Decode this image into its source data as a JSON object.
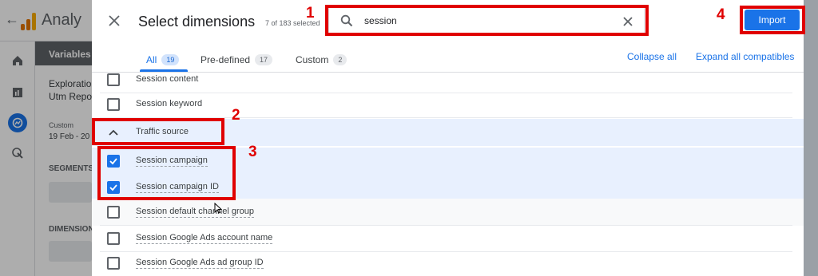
{
  "background_app": {
    "title": "Analy",
    "variables_label": "Variables",
    "exploration_label": "Exploration",
    "report_name": "Utm Repor",
    "date_type": "Custom",
    "date_range": "19 Feb - 20",
    "segments_label": "SEGMENTS",
    "dimensions_label": "DIMENSION"
  },
  "dialog": {
    "title": "Select dimensions",
    "selected_count": "7 of 183 selected",
    "search": {
      "value": "session",
      "placeholder": "Search"
    },
    "import_label": "Import",
    "tabs": [
      {
        "label": "All",
        "count": "19"
      },
      {
        "label": "Pre-defined",
        "count": "17"
      },
      {
        "label": "Custom",
        "count": "2"
      }
    ],
    "collapse_all": "Collapse all",
    "expand_compatibles": "Expand all compatibles",
    "items_top": [
      {
        "label": "Session content",
        "checked": false
      },
      {
        "label": "Session keyword",
        "checked": false
      }
    ],
    "group": {
      "label": "Traffic source",
      "expanded": true
    },
    "items_group": [
      {
        "label": "Session campaign",
        "checked": true
      },
      {
        "label": "Session campaign ID",
        "checked": true
      },
      {
        "label": "Session default channel group",
        "checked": false
      },
      {
        "label": "Session Google Ads account name",
        "checked": false
      },
      {
        "label": "Session Google Ads ad group ID",
        "checked": false
      }
    ]
  },
  "annotations": [
    "1",
    "2",
    "3",
    "4"
  ],
  "colors": {
    "accent": "#1a73e8",
    "annotation": "#e00000",
    "selected_row": "#e8f0fe"
  }
}
